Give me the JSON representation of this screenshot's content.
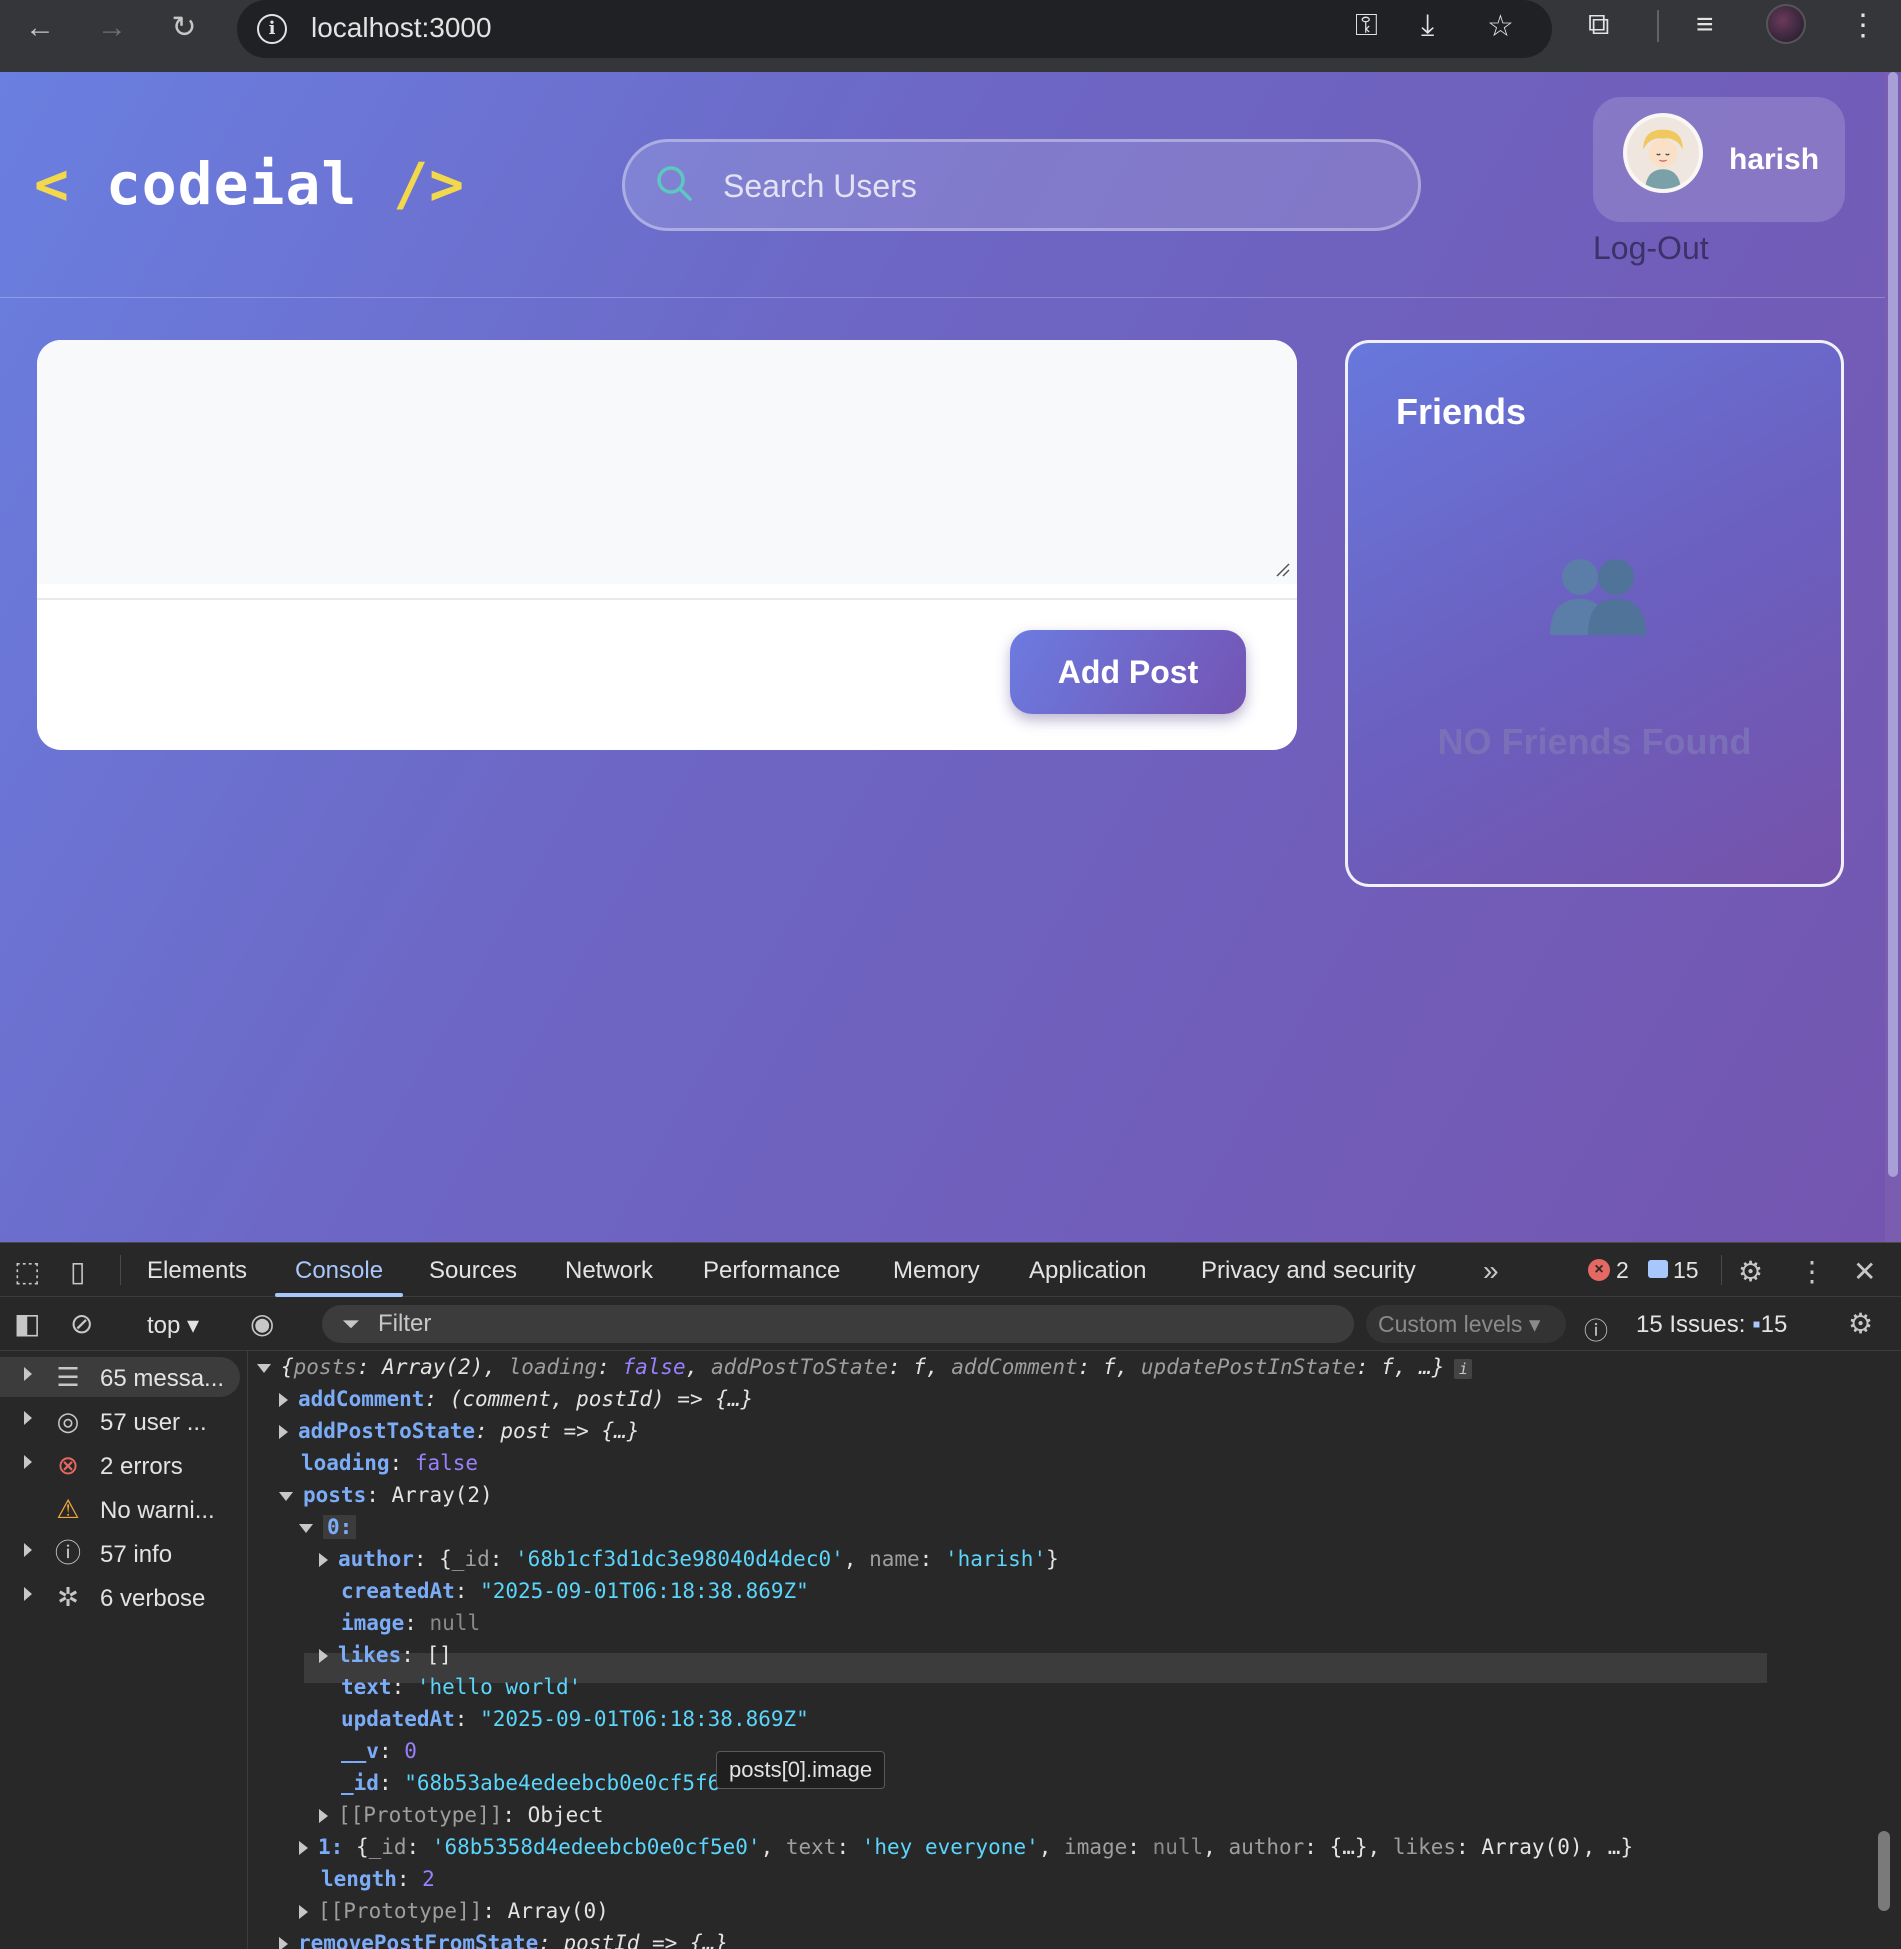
{
  "browser": {
    "url": "localhost:3000",
    "nav": {
      "back": "←",
      "forward": "→",
      "reload": "↻"
    }
  },
  "app": {
    "logo": {
      "open": "<",
      "name": "codeial",
      "close": "/>"
    },
    "search": {
      "placeholder": "Search Users"
    },
    "user": {
      "name": "harish"
    },
    "logout_label": "Log-Out",
    "post": {
      "add_label": "Add Post"
    },
    "friends": {
      "title": "Friends",
      "empty_label": "NO Friends Found"
    }
  },
  "devtools": {
    "tabs": [
      "Elements",
      "Console",
      "Sources",
      "Network",
      "Performance",
      "Memory",
      "Application",
      "Privacy and security"
    ],
    "active_tab": "Console",
    "error_count": "2",
    "message_count": "15",
    "context": "top",
    "filter_placeholder": "Filter",
    "levels_label": "Custom levels",
    "issues_label": "15 Issues:",
    "issues_count": "15",
    "sidebar": [
      {
        "label": "65 messa...",
        "icon": "list-icon"
      },
      {
        "label": "57 user ...",
        "icon": "user-icon"
      },
      {
        "label": "2 errors",
        "icon": "error-icon"
      },
      {
        "label": "No warni...",
        "icon": "warning-icon"
      },
      {
        "label": "57 info",
        "icon": "info-icon"
      },
      {
        "label": "6 verbose",
        "icon": "bug-icon"
      }
    ],
    "console": {
      "summary": {
        "pre": "{",
        "k1": "posts",
        "v1": "Array(2)",
        "k2": "loading",
        "v2": "false",
        "k3": "addPostToState",
        "k4": "addComment",
        "k5": "updatePostInState",
        "fn": "f",
        "tail": "…}"
      },
      "add_comment": {
        "key": "addComment",
        "value": "(comment, postId) => {…}"
      },
      "add_post": {
        "key": "addPostToState",
        "value": "post => {…}"
      },
      "loading": {
        "key": "loading",
        "value": "false"
      },
      "posts": {
        "key": "posts",
        "value": "Array(2)"
      },
      "index0": "0:",
      "author": {
        "key": "author",
        "id_key": "_id",
        "id": "'68b1cf3d1dc3e98040d4dec0'",
        "name_key": "name",
        "name": "'harish'"
      },
      "createdAt": {
        "key": "createdAt",
        "value": "\"2025-09-01T06:18:38.869Z\""
      },
      "image": {
        "key": "image",
        "value": "null"
      },
      "likes": {
        "key": "likes",
        "value": "[]"
      },
      "text": {
        "key": "text",
        "value": "'hello world'"
      },
      "updatedAt": {
        "key": "updatedAt",
        "value": "\"2025-09-01T06:18:38.869Z\""
      },
      "v": {
        "key": "__v",
        "value": "0"
      },
      "id": {
        "key": "_id",
        "value": "\"68b53abe4edeebcb0e0cf5f6\""
      },
      "proto0": {
        "key": "[[Prototype]]",
        "value": "Object"
      },
      "item1": {
        "key": "1:",
        "id_key": "_id",
        "id": "'68b5358d4edeebcb0e0cf5e0'",
        "text_key": "text",
        "text": "'hey everyone'",
        "image_key": "image",
        "image": "null",
        "author_key": "author",
        "author": "{…}",
        "likes_key": "likes",
        "likes": "Array(0)",
        "tail": "…}"
      },
      "length": {
        "key": "length",
        "value": "2"
      },
      "proto1": {
        "key": "[[Prototype]]",
        "value": "Array(0)"
      },
      "remove": {
        "key": "removePostFromState",
        "value": "postId => {…}"
      },
      "tooltip": "posts[0].image"
    }
  }
}
